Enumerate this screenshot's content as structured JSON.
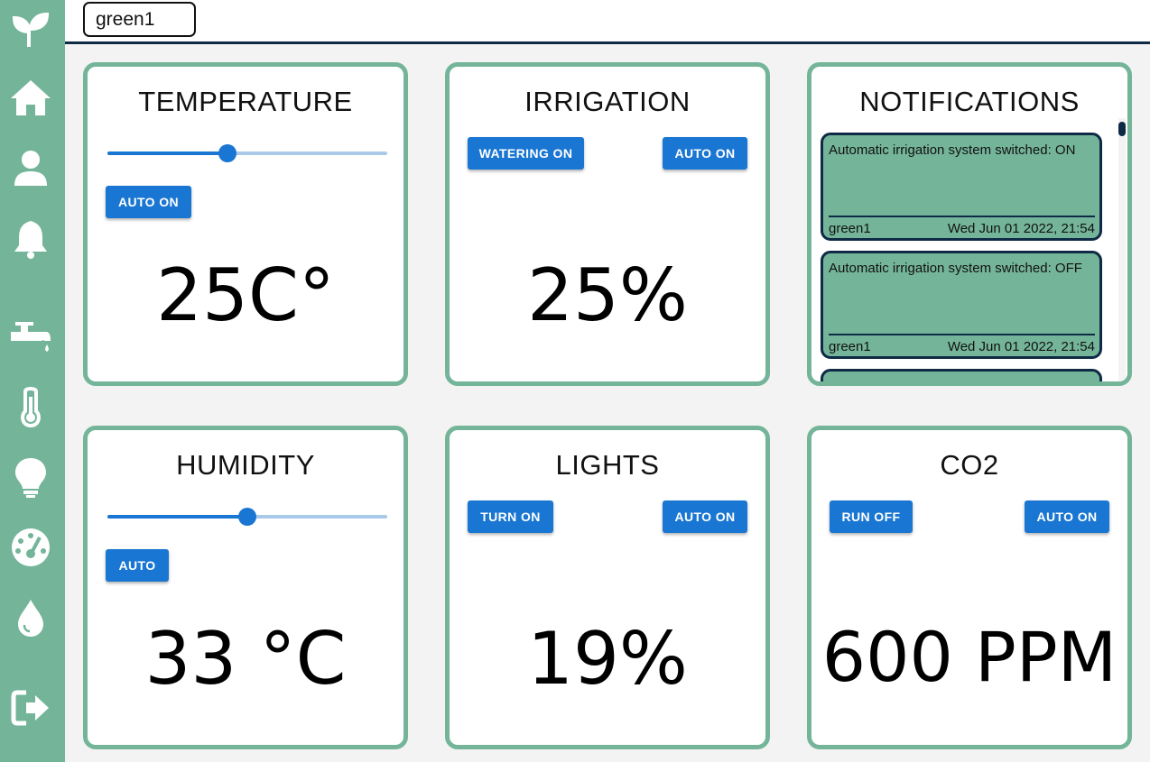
{
  "sidebar": {
    "items": [
      {
        "icon": "sprout-logo-icon"
      },
      {
        "icon": "home-icon"
      },
      {
        "icon": "user-icon"
      },
      {
        "icon": "bell-icon"
      },
      {
        "icon": "faucet-icon"
      },
      {
        "icon": "thermometer-icon"
      },
      {
        "icon": "lightbulb-icon"
      },
      {
        "icon": "gauge-icon"
      },
      {
        "icon": "droplet-icon"
      },
      {
        "icon": "logout-icon"
      }
    ]
  },
  "header": {
    "greenhouse": "green1"
  },
  "colors": {
    "accent": "#1976d2",
    "brand": "#74b59a",
    "dark": "#0e2a45"
  },
  "temperature": {
    "title": "TEMPERATURE",
    "slider_value": 0.43,
    "auto_button": "AUTO ON",
    "value": "25C°"
  },
  "irrigation": {
    "title": "IRRIGATION",
    "watering_button": "WATERING ON",
    "auto_button": "AUTO ON",
    "value": "25%"
  },
  "notifications": {
    "title": "NOTIFICATIONS",
    "items": [
      {
        "message": "Automatic irrigation system switched: ON",
        "greenhouse": "green1",
        "time": "Wed Jun 01 2022, 21:54"
      },
      {
        "message": "Automatic irrigation system switched: OFF",
        "greenhouse": "green1",
        "time": "Wed Jun 01 2022, 21:54"
      }
    ]
  },
  "humidity": {
    "title": "HUMIDITY",
    "slider_value": 0.5,
    "auto_button": "AUTO",
    "value": "33 °C"
  },
  "lights": {
    "title": "LIGHTS",
    "turn_button": "TURN ON",
    "auto_button": "AUTO ON",
    "value": "19%"
  },
  "co2": {
    "title": "CO2",
    "run_button": "RUN OFF",
    "auto_button": "AUTO ON",
    "value": "600 PPM"
  }
}
